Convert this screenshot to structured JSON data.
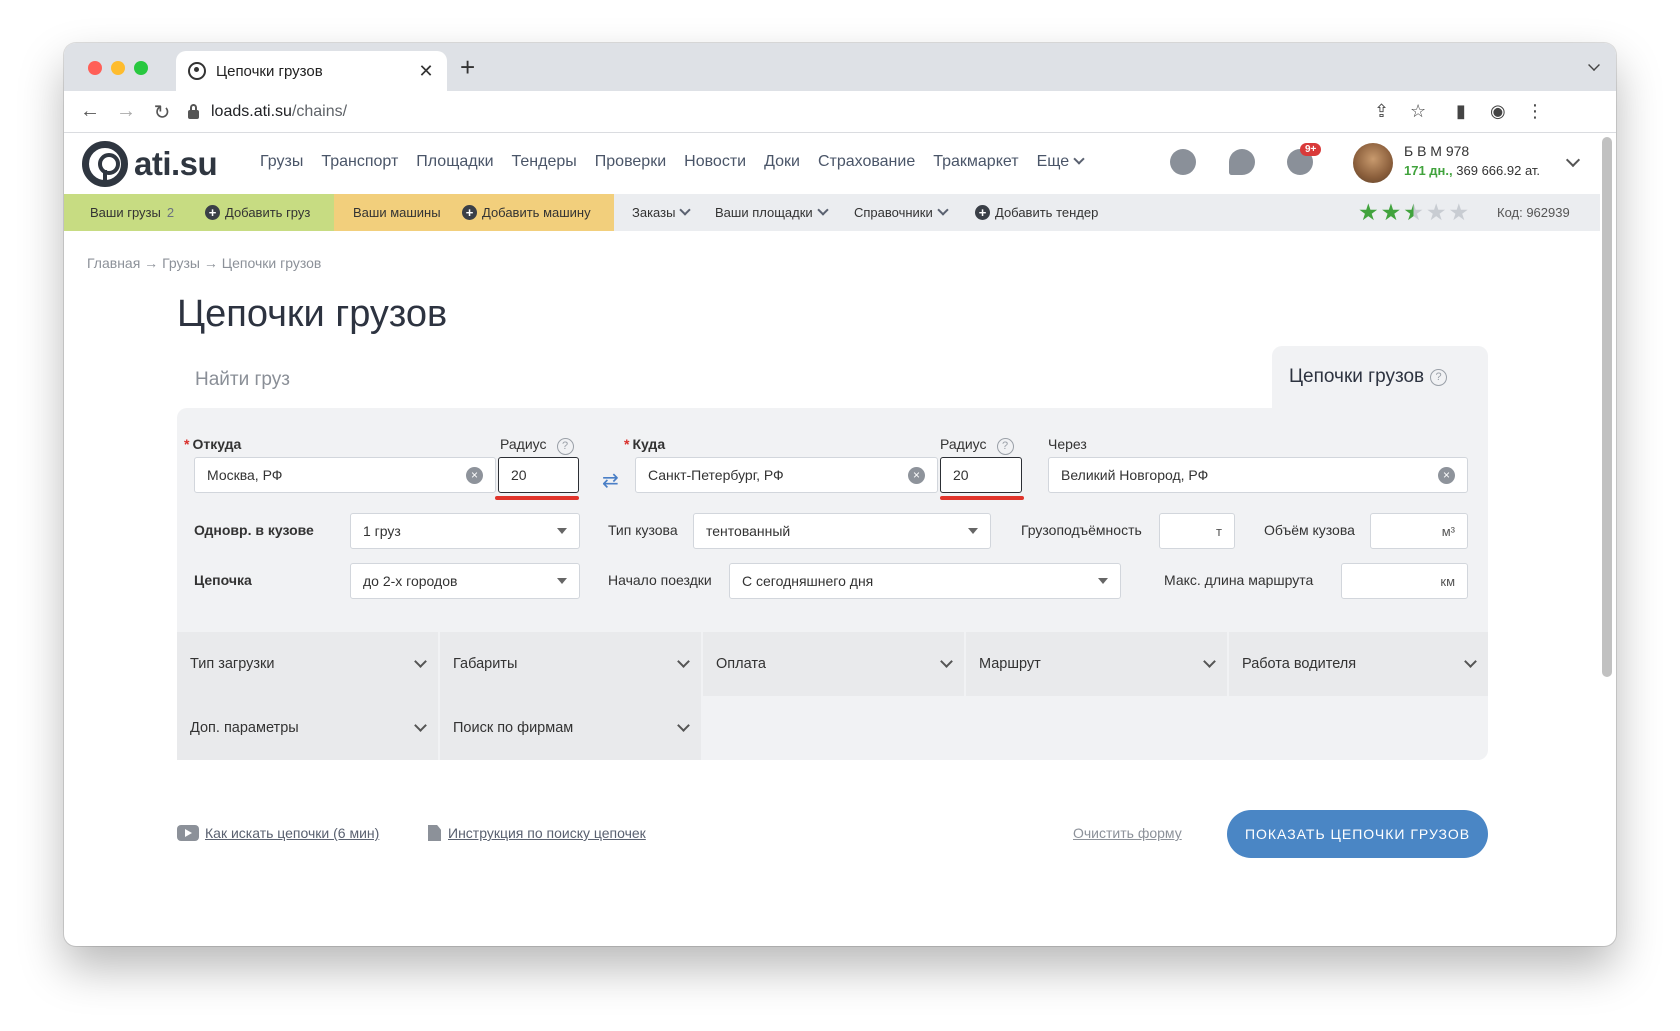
{
  "browser": {
    "tab_title": "Цепочки грузов",
    "tab_close": "✕",
    "new_tab": "+",
    "url_host": "loads.ati.su",
    "url_path": "/chains/",
    "traffic_lights": [
      "#ff5f57",
      "#febc2e",
      "#28c840"
    ]
  },
  "site": {
    "logo_text": "ati.su",
    "nav": [
      "Грузы",
      "Транспорт",
      "Площадки",
      "Тендеры",
      "Проверки",
      "Новости",
      "Доки",
      "Страхование",
      "Тракмаркет",
      "Еще"
    ],
    "notifications_badge": "9+",
    "user_name": "Б В М 978",
    "user_days": "171 дн.,",
    "user_balance": "369 666.92 ат."
  },
  "subbar": {
    "your_loads": "Ваши грузы",
    "your_loads_count": "2",
    "add_load": "Добавить груз",
    "your_trucks": "Ваши машины",
    "add_truck": "Добавить машину",
    "orders": "Заказы",
    "your_platforms": "Ваши площадки",
    "directories": "Справочники",
    "add_tender": "Добавить тендер",
    "rating": 2.5,
    "code": "Код: 962939"
  },
  "page": {
    "breadcrumb": "Главная → Грузы → Цепочки грузов",
    "title": "Цепочки грузов",
    "tab_find": "Найти груз",
    "tab_chains": "Цепочки грузов",
    "help": "?"
  },
  "form": {
    "from_label": "Откуда",
    "required_mark": "*",
    "radius_label": "Радиус",
    "from_value": "Москва, РФ",
    "from_radius": "20",
    "to_label": "Куда",
    "to_value": "Санкт-Петербург, РФ",
    "to_radius": "20",
    "via_label": "Через",
    "via_value": "Великий Новгород, РФ",
    "simultaneous_label": "Одновр. в кузове",
    "simultaneous_value": "1 груз",
    "body_type_label": "Тип кузова",
    "body_type_value": "тентованный",
    "capacity_label": "Грузоподъёмность",
    "capacity_unit": "т",
    "volume_label": "Объём кузова",
    "volume_unit": "м³",
    "chain_label": "Цепочка",
    "chain_value": "до 2-х городов",
    "trip_start_label": "Начало поездки",
    "trip_start_value": "С сегодняшнего дня",
    "max_route_label": "Макс. длина маршрута",
    "max_route_unit": "км",
    "clear_x": "×"
  },
  "accordions": {
    "row1": [
      "Тип загрузки",
      "Габариты",
      "Оплата",
      "Маршрут",
      "Работа водителя"
    ],
    "row2": [
      "Доп. параметры",
      "Поиск по фирмам"
    ]
  },
  "footer": {
    "video_link": "Как искать цепочки (6 мин)",
    "instructions_link": "Инструкция по поиску цепочек",
    "clear_form": "Очистить форму",
    "submit": "ПОКАЗАТЬ ЦЕПОЧКИ ГРУЗОВ"
  }
}
